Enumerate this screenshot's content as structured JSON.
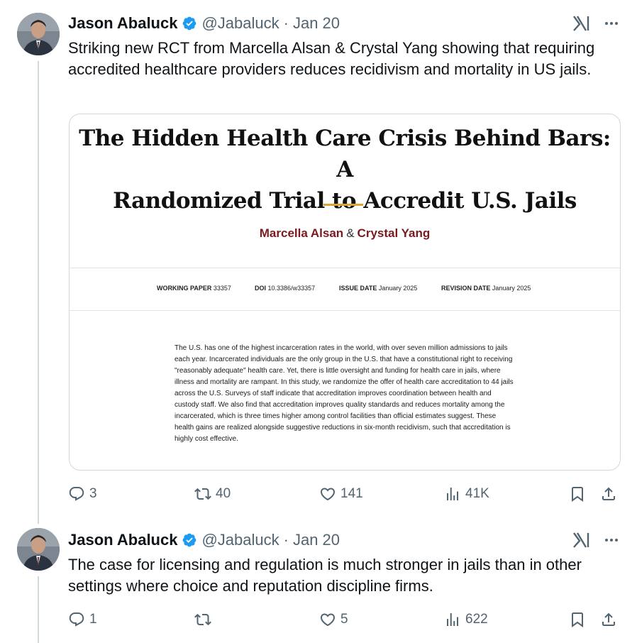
{
  "colors": {
    "text": "#0f1419",
    "muted": "#536471",
    "verified": "#1d9bf0",
    "author_red": "#7a1a1f",
    "gold": "#d9a535",
    "divider": "#cfd9de"
  },
  "tweets": [
    {
      "author": {
        "name": "Jason Abaluck",
        "handle": "@Jabaluck",
        "date": "Jan 20",
        "verified_icon": "verified-badge-icon",
        "avatar": "avatar-photo"
      },
      "text": "Striking new RCT from Marcella Alsan & Crystal Yang showing that requiring accredited healthcare providers reduces recidivism and mortality in US jails.",
      "card": {
        "title_line1": "The Hidden Health Care Crisis Behind Bars: A",
        "title_line2": "Randomized Trial to Accredit U.S. Jails",
        "author1": "Marcella Alsan",
        "amp": "&",
        "author2": "Crystal Yang",
        "meta": {
          "wp_label": "WORKING PAPER",
          "wp_value": "33357",
          "doi_label": "DOI",
          "doi_value": "10.3386/w33357",
          "issue_label": "ISSUE DATE",
          "issue_value": "January 2025",
          "rev_label": "REVISION DATE",
          "rev_value": "January 2025"
        },
        "abstract": "The U.S. has one of the highest incarceration rates in the world, with over seven million admissions to jails each year. Incarcerated individuals are the only group in the U.S. that have a constitutional right to receiving \"reasonably adequate\" health care. Yet, there is little oversight and funding for health care in jails, where illness and mortality are rampant. In this study, we randomize the offer of health care accreditation to 44 jails across the U.S. Surveys of staff indicate that accreditation improves coordination between health and custody staff. We also find that accreditation improves quality standards and reduces mortality among the incarcerated, which is three times higher among control facilities than official estimates suggest. These health gains are realized alongside suggestive reductions in six-month recidivism, such that accreditation is highly cost effective."
      },
      "actions": {
        "replies": "3",
        "reposts": "40",
        "likes": "141",
        "views": "41K"
      }
    },
    {
      "author": {
        "name": "Jason Abaluck",
        "handle": "@Jabaluck",
        "date": "Jan 20",
        "verified_icon": "verified-badge-icon",
        "avatar": "avatar-photo"
      },
      "text": "The case for licensing and regulation is much stronger in jails than in other settings where choice and reputation discipline firms.",
      "actions": {
        "replies": "1",
        "reposts": "",
        "likes": "5",
        "views": "622"
      }
    }
  ],
  "separator": "·"
}
